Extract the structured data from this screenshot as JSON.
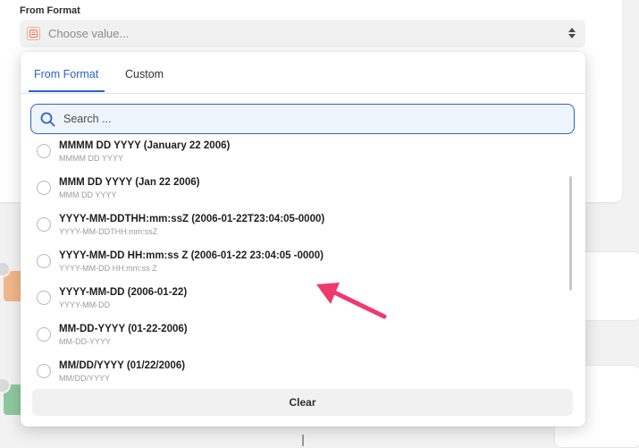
{
  "field": {
    "label": "From Format",
    "placeholder": "Choose value..."
  },
  "tabs": [
    {
      "label": "From Format",
      "active": true
    },
    {
      "label": "Custom",
      "active": false
    }
  ],
  "search": {
    "placeholder": "Search ..."
  },
  "options": [
    {
      "title": "MMMM DD YYYY (January 22 2006)",
      "sub": "MMMM DD YYYY"
    },
    {
      "title": "MMM DD YYYY (Jan 22 2006)",
      "sub": "MMM DD YYYY"
    },
    {
      "title": "YYYY-MM-DDTHH:mm:ssZ (2006-01-22T23:04:05-0000)",
      "sub": "YYYY-MM-DDTHH:mm:ssZ"
    },
    {
      "title": "YYYY-MM-DD HH:mm:ss Z (2006-01-22 23:04:05 -0000)",
      "sub": "YYYY-MM-DD HH:mm:ss Z"
    },
    {
      "title": "YYYY-MM-DD (2006-01-22)",
      "sub": "YYYY-MM-DD"
    },
    {
      "title": "MM-DD-YYYY (01-22-2006)",
      "sub": "MM-DD-YYYY"
    },
    {
      "title": "MM/DD/YYYY (01/22/2006)",
      "sub": "MM/DD/YYYY"
    }
  ],
  "clear_label": "Clear",
  "colors": {
    "accent": "#2a63c9",
    "annotation_arrow": "#f0396c"
  },
  "icons": {
    "field_icon": "formatter-icon",
    "select_caret": "up-down-caret-icon",
    "search": "search-icon",
    "annotation": "pink-arrow-icon"
  }
}
